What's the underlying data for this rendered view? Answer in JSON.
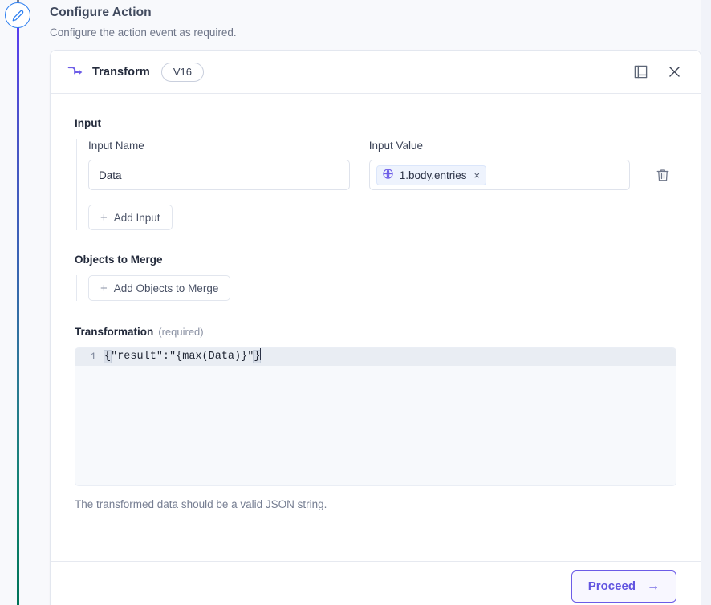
{
  "page": {
    "title": "Configure Action",
    "subtitle": "Configure the action event as required."
  },
  "rail": {
    "node_icon": "pencil-icon"
  },
  "card": {
    "node_icon": "transform-arrow-icon",
    "title": "Transform",
    "version": "V16",
    "docs_icon": "book-icon",
    "close_icon": "close-icon"
  },
  "input_section": {
    "label": "Input",
    "name_label": "Input Name",
    "value_label": "Input Value",
    "name_value": "Data",
    "name_placeholder": "Input Name",
    "token": {
      "icon": "globe-icon",
      "text": "1.body.entries",
      "remove_label": "×"
    },
    "delete_icon": "trash-icon",
    "add_button": "Add Input",
    "add_icon": "plus-icon"
  },
  "merge_section": {
    "label": "Objects to Merge",
    "add_button": "Add Objects to Merge",
    "add_icon": "plus-icon"
  },
  "transformation_section": {
    "label": "Transformation",
    "required_note": "(required)",
    "line_number": "1",
    "code_open_brace": "{",
    "code_middle": "\"result\":\"{max(Data)}\"",
    "code_close_brace": "}",
    "code_full": "{\"result\":\"{max(Data)}\"}",
    "hint": "The transformed data should be a valid JSON string."
  },
  "footer": {
    "proceed_label": "Proceed",
    "proceed_arrow": "→"
  },
  "colors": {
    "accent": "#6154e0",
    "rail_top": "#5b3ef0",
    "rail_bottom": "#007258",
    "node_border": "#2d7ff0",
    "token_bg": "#eef3fd",
    "code_line_bg": "#e9edf3"
  }
}
